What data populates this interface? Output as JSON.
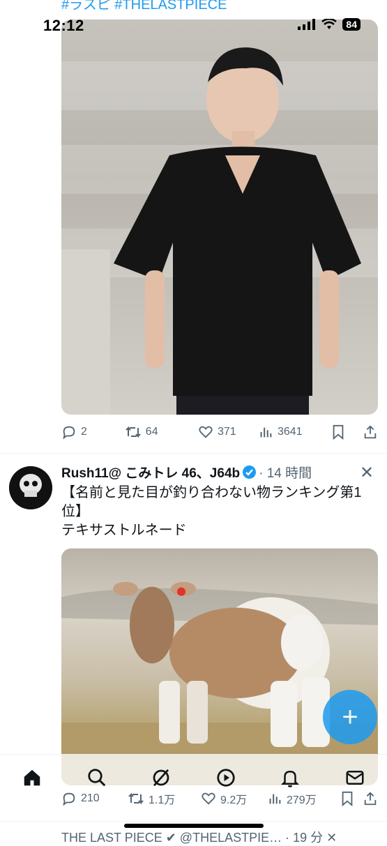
{
  "status": {
    "time": "12:12",
    "battery": "84"
  },
  "tweet1": {
    "hashtags": "#ラスピ #THELASTPIECE",
    "image_alt": "",
    "actions": {
      "replies": "2",
      "retweets": "64",
      "likes": "371",
      "views": "3641"
    }
  },
  "tweet2": {
    "name": "Rush11@ こみトレ 46、J64b",
    "meta": "· 14 時間",
    "close": "✕",
    "text_line1": "【名前と見た目が釣り合わない物ランキング第1位】",
    "text_line2": "テキサストルネード",
    "actions": {
      "replies": "210",
      "retweets": "1.1万",
      "likes": "9.2万",
      "views": "279万"
    }
  },
  "tweet3": {
    "partial_header": "THE LAST PIECE ✔ @THELASTPIE… · 19 分 ✕"
  },
  "fab": {
    "label": "+"
  },
  "nav": [
    "home-icon",
    "search-icon",
    "grok-icon",
    "media-icon",
    "notifications-icon",
    "messages-icon"
  ],
  "colors": {
    "accent": "#1d9bf0",
    "secondary_text": "#536471"
  }
}
